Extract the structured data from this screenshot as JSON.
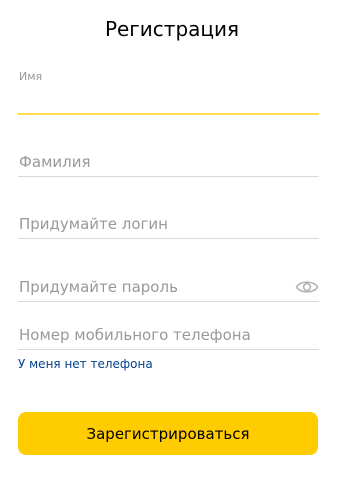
{
  "page": {
    "title": "Регистрация"
  },
  "form": {
    "first_name": {
      "label": "Имя",
      "value": "",
      "placeholder": ""
    },
    "last_name": {
      "value": "",
      "placeholder": "Фамилия"
    },
    "login": {
      "value": "",
      "placeholder": "Придумайте логин"
    },
    "password": {
      "value": "",
      "placeholder": "Придумайте пароль",
      "toggle_icon": "eye-icon"
    },
    "phone": {
      "value": "",
      "placeholder": "Номер мобильного телефона"
    },
    "no_phone_link": "У меня нет телефона",
    "submit_label": "Зарегистрироваться"
  },
  "colors": {
    "accent": "#ffcc00",
    "active_underline": "#ffdb4d",
    "link": "#04408f",
    "placeholder": "#999999",
    "divider": "#d8d8d8"
  }
}
